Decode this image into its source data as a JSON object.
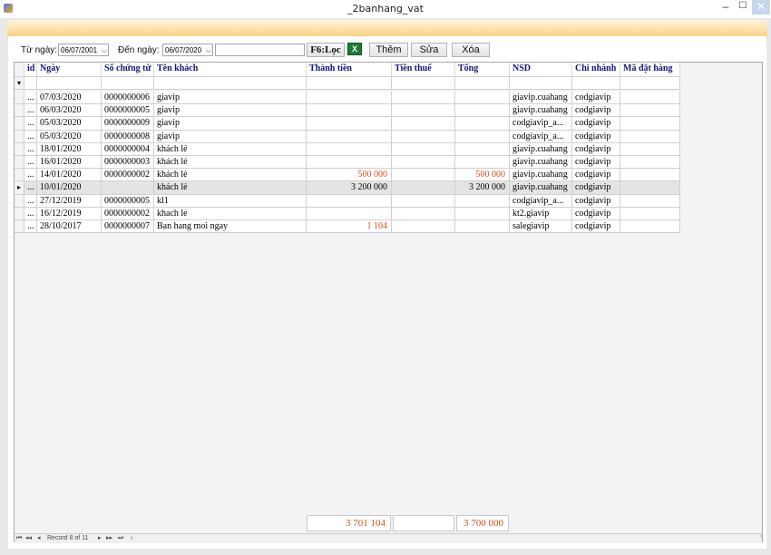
{
  "window": {
    "title": "_2banhang_vat",
    "minimize": "–",
    "maximize": "☐",
    "close": "✕"
  },
  "toolbar": {
    "from_label": "Từ ngày:",
    "from_date": "06/07/2001",
    "to_label": "Đến ngày:",
    "to_date": "06/07/2020",
    "search_value": "",
    "filter_label": "F6:Lọc",
    "excel_icon": "excel-icon",
    "add_label": "Thêm",
    "edit_label": "Sửa",
    "delete_label": "Xóa"
  },
  "grid": {
    "columns": [
      "id",
      "Ngày",
      "Số chứng từ",
      "Tên khách",
      "Thành tiền",
      "Tiền thuế",
      "Tổng",
      "NSD",
      "Chi nhánh",
      "Mã đặt hàng"
    ],
    "rows": [
      {
        "id": "...",
        "date": "07/03/2020",
        "doc": "0000000006",
        "customer": "giavip",
        "amount": "",
        "tax": "",
        "total": "",
        "user": "giavip.cuahang",
        "branch": "codgiavip",
        "order": ""
      },
      {
        "id": "...",
        "date": "06/03/2020",
        "doc": "0000000005",
        "customer": "giavip",
        "amount": "",
        "tax": "",
        "total": "",
        "user": "giavip.cuahang",
        "branch": "codgiavip",
        "order": ""
      },
      {
        "id": "...",
        "date": "05/03/2020",
        "doc": "0000000009",
        "customer": "giavip",
        "amount": "",
        "tax": "",
        "total": "",
        "user": "codgiavip_a...",
        "branch": "codgiavip",
        "order": ""
      },
      {
        "id": "...",
        "date": "05/03/2020",
        "doc": "0000000008",
        "customer": "giavip",
        "amount": "",
        "tax": "",
        "total": "",
        "user": "codgiavip_a...",
        "branch": "codgiavip",
        "order": ""
      },
      {
        "id": "...",
        "date": "18/01/2020",
        "doc": "0000000004",
        "customer": "khách lẻ",
        "amount": "",
        "tax": "",
        "total": "",
        "user": "giavip.cuahang",
        "branch": "codgiavip",
        "order": ""
      },
      {
        "id": "...",
        "date": "16/01/2020",
        "doc": "0000000003",
        "customer": "khách lẻ",
        "amount": "",
        "tax": "",
        "total": "",
        "user": "giavip.cuahang",
        "branch": "codgiavip",
        "order": ""
      },
      {
        "id": "...",
        "date": "14/01/2020",
        "doc": "0000000002",
        "customer": "khách lẻ",
        "amount": "500 000",
        "tax": "",
        "total": "500 000",
        "user": "giavip.cuahang",
        "branch": "codgiavip",
        "order": ""
      },
      {
        "id": "...",
        "date": "10/01/2020",
        "doc": "",
        "customer": "khách lẻ",
        "amount": "3 200 000",
        "tax": "",
        "total": "3 200 000",
        "user": "giavip.cuahang",
        "branch": "codgiavip",
        "order": ""
      },
      {
        "id": "...",
        "date": "27/12/2019",
        "doc": "0000000005",
        "customer": "kl1",
        "amount": "",
        "tax": "",
        "total": "",
        "user": "codgiavip_a...",
        "branch": "codgiavip",
        "order": ""
      },
      {
        "id": "...",
        "date": "16/12/2019",
        "doc": "0000000002",
        "customer": "khach le",
        "amount": "",
        "tax": "",
        "total": "",
        "user": "kt2.giavip",
        "branch": "codgiavip",
        "order": ""
      },
      {
        "id": "...",
        "date": "28/10/2017",
        "doc": "0000000007",
        "customer": "Ban hang moi ngay",
        "amount": "1 104",
        "tax": "",
        "total": "",
        "user": "salegiavip",
        "branch": "codgiavip",
        "order": ""
      }
    ],
    "selected_row": 7,
    "filter_icon": "filter-icon",
    "row_pointer": "▸",
    "accent_red": "#d4501c",
    "header_color": "#14147d"
  },
  "totals": {
    "amount": "3 701 104",
    "tax": "",
    "total": "3 700 000"
  },
  "navigator": {
    "first": "⏮",
    "prev_page": "◂◂",
    "prev": "◂",
    "record_text": "Record 8 of 11",
    "next": "▸",
    "next_page": "▸▸",
    "last": "⏭",
    "scroll_left": "‹",
    "scroll_right": "›"
  }
}
